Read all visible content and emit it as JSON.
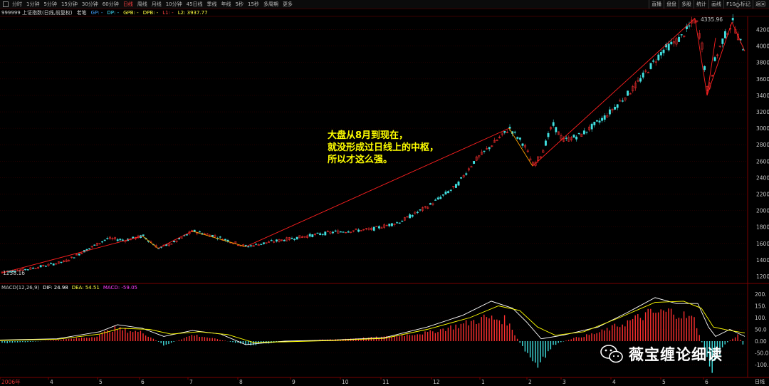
{
  "toolbar": {
    "periods": [
      "分时",
      "1分钟",
      "5分钟",
      "15分钟",
      "30分钟",
      "60分钟",
      "日线",
      "周线",
      "月线",
      "10分钟",
      "45日线",
      "季线",
      "年线",
      "5秒",
      "15秒",
      "多周期",
      "更多"
    ],
    "active_period": "日线",
    "right_buttons": [
      "直播",
      "盘盘",
      "多股",
      "统计",
      "画线",
      "F10",
      "标记",
      "返回"
    ]
  },
  "info": {
    "symbol": "999999 上证指数(日线,前复权)",
    "indicator": "老笔",
    "gp": "GP: -",
    "dp": "DP: -",
    "gpb": "GPB: -",
    "dpb": "DPB: -",
    "l1": "L1: -",
    "l2": "L2: 3937.77"
  },
  "chart": {
    "high_label": "4335.96",
    "low_label": "1238.16",
    "annotation": [
      "大盘从8月到现在，",
      "就没形成过日线上的中枢，",
      "所以才这么强。"
    ],
    "colors": {
      "up": "#ff3030",
      "down": "#40e0e0",
      "stroke_line": "#ff2020",
      "pivot": "#ffa000",
      "dif": "#ffffff",
      "dea": "#ffff00",
      "grid": "#3a0000"
    }
  },
  "macd": {
    "title": "MACD(12,26,9)",
    "dif": "DIF: 24.98",
    "dea": "DEA: 54.51",
    "macd": "MACD: -59.05"
  },
  "watermark": "薇宝缠论细读",
  "tab_day": "日线",
  "chart_data": {
    "type": "candlestick",
    "y_axis_price": [
      "4200",
      "4000",
      "3800",
      "3600",
      "3400",
      "3200",
      "3000",
      "2800",
      "2600",
      "2400",
      "2200",
      "2000",
      "1800",
      "1600",
      "1400",
      "1200"
    ],
    "y_axis_macd": [
      "200.",
      "150.",
      "100.",
      "50.0",
      "0.00",
      "-50.0",
      "-100."
    ],
    "x_axis": [
      "2006年",
      "4",
      "5",
      "6",
      "7",
      "8",
      "9",
      "10",
      "11",
      "12",
      "1",
      "2",
      "3",
      "4",
      "5",
      "6"
    ],
    "strokes": [
      {
        "from": [
          0,
          1238
        ],
        "to": [
          1,
          1690
        ]
      },
      {
        "from": [
          1,
          1690
        ],
        "to": [
          2,
          1540
        ]
      },
      {
        "from": [
          2,
          1540
        ],
        "to": [
          3,
          1750
        ]
      },
      {
        "from": [
          3,
          1750
        ],
        "to": [
          4,
          1560
        ]
      },
      {
        "from": [
          4,
          1560
        ],
        "to": [
          5,
          3000
        ]
      },
      {
        "from": [
          5,
          3000
        ],
        "to": [
          6,
          2540
        ]
      },
      {
        "from": [
          6,
          2540
        ],
        "to": [
          7,
          4336
        ]
      },
      {
        "from": [
          7,
          4336
        ],
        "to": [
          8,
          3400
        ]
      },
      {
        "from": [
          8,
          3400
        ],
        "to": [
          9,
          4290
        ]
      },
      {
        "from": [
          9,
          4290
        ],
        "to": [
          10,
          3937
        ]
      }
    ]
  }
}
